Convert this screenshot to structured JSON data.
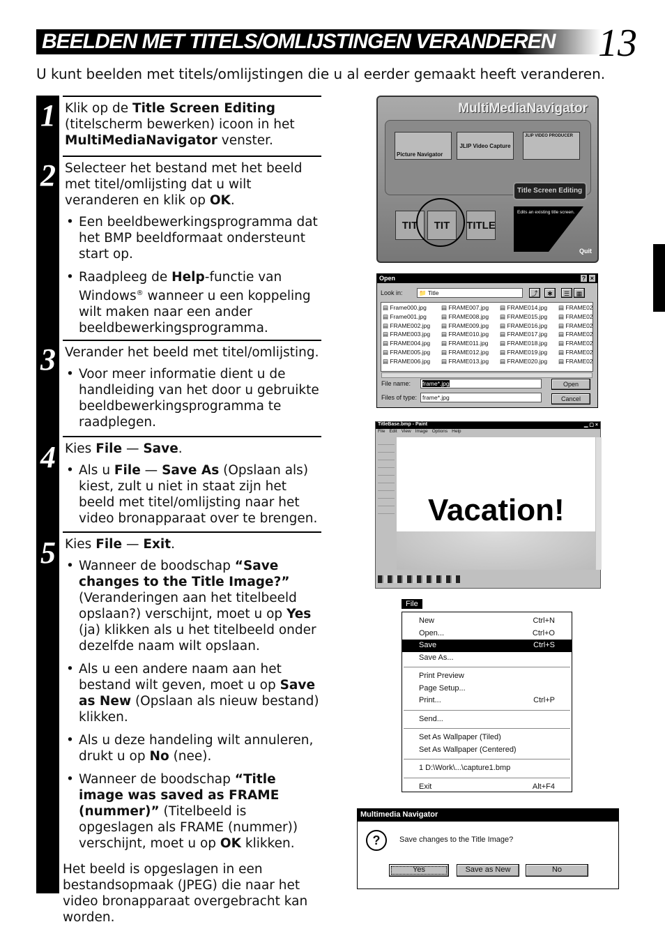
{
  "header": {
    "title": "BEELDEN MET TITELS/OMLIJSTINGEN VERANDEREN",
    "page_number": "13"
  },
  "intro": "U kunt beelden met titels/omlijstingen die u al eerder gemaakt heeft veranderen.",
  "steps": [
    {
      "num": "1",
      "a": "Klik op de ",
      "b": "Title Screen Editing",
      "c": " (titelscherm bewerken) icoon in het ",
      "d": "MultiMediaNavigator",
      "e": " venster."
    },
    {
      "num": "2",
      "a": "Selecteer het bestand met het beeld met titel/omlijsting dat u wilt veranderen en klik op ",
      "b": "OK",
      "c": ".",
      "bullet1": "Een beeldbewerkingsprogramma dat het BMP beeldformaat ondersteunt start op.",
      "bullet2a": "Raadpleeg de ",
      "bullet2b": "Help",
      "bullet2c": "-functie van Windows",
      "bullet2reg": "®",
      "bullet2d": " wanneer u een koppeling wilt maken naar een ander beeldbewerkingsprogramma."
    },
    {
      "num": "3",
      "a": "Verander het beeld met titel/omlijsting.",
      "bullet1": "Voor meer informatie dient u de handleiding van het door u gebruikte beeldbewerkingsprogramma te raadplegen."
    },
    {
      "num": "4",
      "a": "Kies ",
      "b": "File",
      "c": " — ",
      "d": "Save",
      "e": ".",
      "bullet1a": "Als u ",
      "bullet1b": "File",
      "bullet1c": " — ",
      "bullet1d": "Save As",
      "bullet1e": " (Opslaan als) kiest, zult u niet in staat zijn het beeld met titel/omlijsting naar het video bronapparaat over te brengen."
    },
    {
      "num": "5",
      "a": "Kies ",
      "b": "File",
      "c": " — ",
      "d": "Exit",
      "e": ".",
      "b1a": "Wanneer de boodschap ",
      "b1b": "“Save changes to the Title Image?”",
      "b1c": " (Veranderingen aan het titelbeeld opslaan?) verschijnt, moet u op ",
      "b1d": "Yes",
      "b1e": " (ja) klikken als u het titelbeeld onder dezelfde naam wilt opslaan.",
      "b2a": "Als u een andere naam aan het bestand wilt geven, moet u op ",
      "b2b": "Save as New",
      "b2c": " (Opslaan als nieuw bestand) klikken.",
      "b3a": "Als u deze handeling wilt annuleren, drukt u op ",
      "b3b": "No",
      "b3c": " (nee).",
      "b4a": "Wanneer de boodschap ",
      "b4b": "“Title image was saved as FRAME (nummer)”",
      "b4c": " (Titelbeeld is opgeslagen als FRAME (nummer)) verschijnt, moet u op ",
      "b4d": "OK",
      "b4e": " klikken.",
      "closing": "Het beeld is opgeslagen in een bestandsopmaak (JPEG) die naar het video bronapparaat overgebracht kan worden."
    }
  ],
  "mmn": {
    "title": "MultiMediaNavigator",
    "tiles": [
      "Picture Navigator",
      "JLIP Video Capture",
      "JLIP VIDEO PRODUCER"
    ],
    "icons": [
      "TIT",
      "TIT",
      "TITLE"
    ],
    "label": "Title Screen Editing",
    "desc": "Edits an existing title screen.",
    "quit": "Quit"
  },
  "open": {
    "title": "Open",
    "help": "?",
    "close": "×",
    "look_in_label": "Look in:",
    "look_in": "Title",
    "files": [
      "Frame000.jpg",
      "Frame001.jpg",
      "FRAME002.jpg",
      "FRAME003.jpg",
      "FRAME004.jpg",
      "FRAME005.jpg",
      "FRAME006.jpg",
      "FRAME007.jpg",
      "FRAME008.jpg",
      "FRAME009.jpg",
      "FRAME010.jpg",
      "FRAME011.jpg",
      "FRAME012.jpg",
      "FRAME013.jpg",
      "FRAME014.jpg",
      "FRAME015.jpg",
      "FRAME016.jpg",
      "FRAME017.jpg",
      "FRAME018.jpg",
      "FRAME019.jpg",
      "FRAME020.jpg",
      "FRAME02",
      "FRAME02",
      "FRAME02",
      "FRAME02",
      "FRAME02",
      "FRAME02",
      "FRAME02"
    ],
    "file_name_label": "File name:",
    "file_name": "frame*.jpg",
    "type_label": "Files of type:",
    "type": "frame*.jpg",
    "open_btn": "Open",
    "cancel_btn": "Cancel"
  },
  "paint": {
    "title": "TitleBase.bmp - Paint",
    "menus": [
      "File",
      "Edit",
      "View",
      "Image",
      "Options",
      "Help"
    ],
    "canvas_text": "Vacation!"
  },
  "menu": {
    "title": "File",
    "items": [
      {
        "label": "New",
        "key": "Ctrl+N"
      },
      {
        "label": "Open...",
        "key": "Ctrl+O"
      },
      {
        "label": "Save",
        "key": "Ctrl+S",
        "selected": true
      },
      {
        "label": "Save As...",
        "key": ""
      },
      {
        "sep": true
      },
      {
        "label": "Print Preview",
        "key": ""
      },
      {
        "label": "Page Setup...",
        "key": ""
      },
      {
        "label": "Print...",
        "key": "Ctrl+P"
      },
      {
        "sep": true
      },
      {
        "label": "Send...",
        "key": ""
      },
      {
        "sep": true
      },
      {
        "label": "Set As Wallpaper (Tiled)",
        "key": ""
      },
      {
        "label": "Set As Wallpaper (Centered)",
        "key": ""
      },
      {
        "sep": true
      },
      {
        "label": "1 D:\\Work\\...\\capture1.bmp",
        "key": ""
      },
      {
        "sep": true
      },
      {
        "label": "Exit",
        "key": "Alt+F4"
      }
    ]
  },
  "dialog": {
    "title": "Multimedia Navigator",
    "message": "Save changes to the Title Image?",
    "buttons": [
      "Yes",
      "Save as New",
      "No"
    ]
  }
}
